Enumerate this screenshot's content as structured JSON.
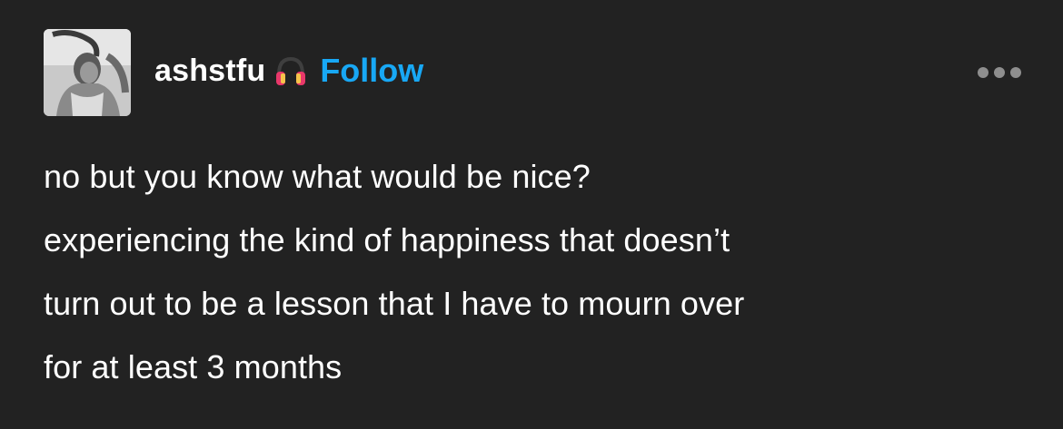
{
  "post": {
    "author": {
      "username": "ashstfu",
      "badge_icon": "headphones-icon",
      "avatar": "profile-photo"
    },
    "follow_label": "Follow",
    "more_icon": "ellipsis-icon",
    "body_lines": [
      "no but you know what would be nice?",
      "experiencing the kind of happiness that doesn’t",
      "turn out to be a lesson that I have to mourn over",
      "for at least 3 months"
    ]
  },
  "colors": {
    "background": "#222222",
    "text": "#ffffff",
    "follow": "#18a8f5",
    "more_dots": "#8e8e8e"
  }
}
